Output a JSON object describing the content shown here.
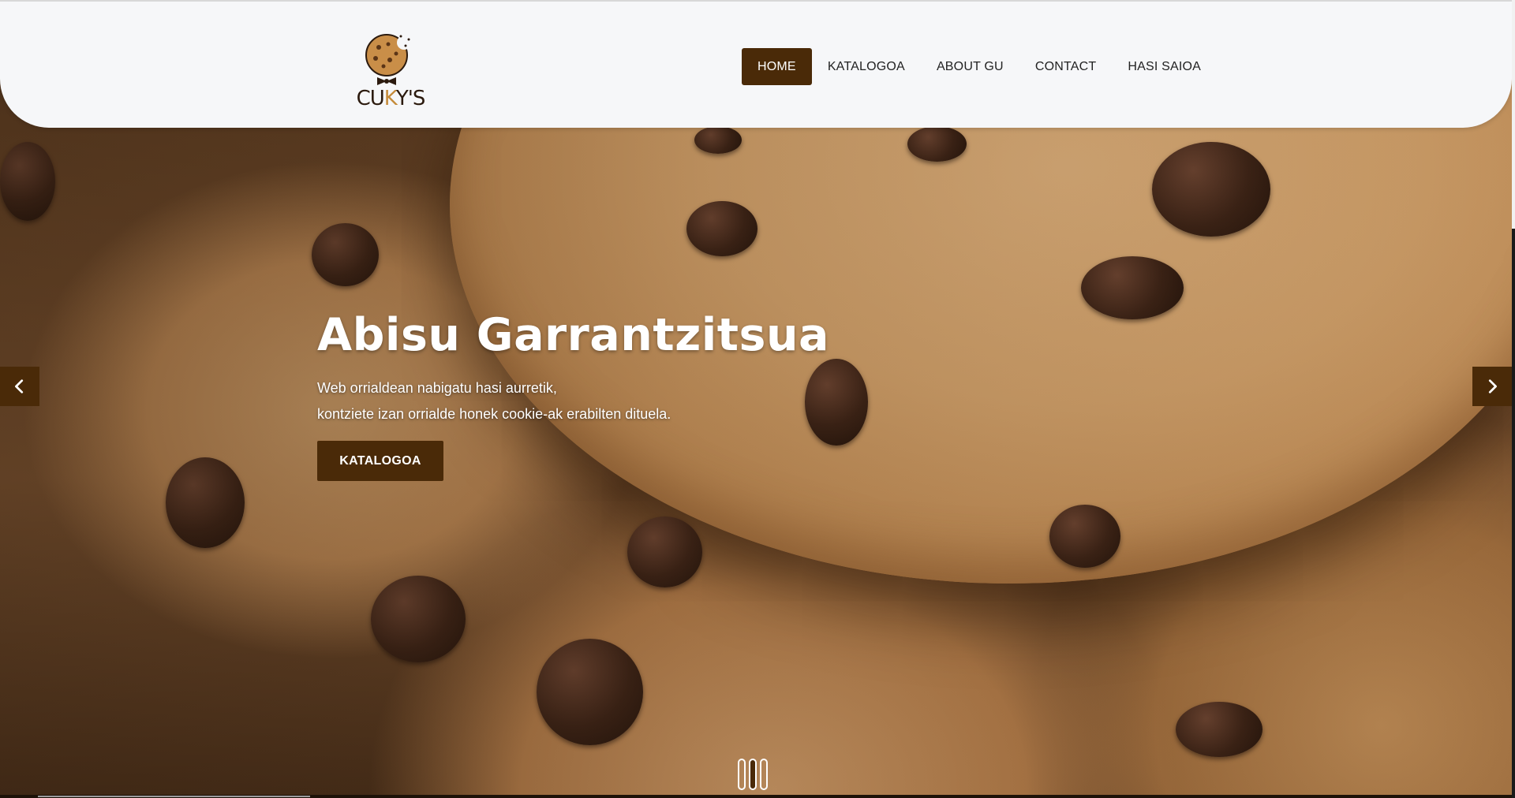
{
  "header": {
    "logo_text_left": "CU",
    "logo_text_k": "K",
    "logo_text_right": "Y'S",
    "nav": [
      {
        "label": "HOME",
        "active": true
      },
      {
        "label": "KATALOGOA",
        "active": false
      },
      {
        "label": "ABOUT GU",
        "active": false
      },
      {
        "label": "CONTACT",
        "active": false
      },
      {
        "label": "HASI SAIOA",
        "active": false
      }
    ]
  },
  "hero": {
    "title": "Abisu Garrantzitsua",
    "line1": "Web orrialdean nabigatu hasi aurretik,",
    "line2": "kontziete izan orrialde honek cookie-ak erabilten dituela.",
    "cta_label": "KATALOGOA"
  },
  "carousel": {
    "prev_icon": "chevron-left-icon",
    "next_icon": "chevron-right-icon",
    "slide_count": 3,
    "active_slide": 1
  },
  "colors": {
    "brand": "#4a2a08",
    "header_bg": "#f6f7f9",
    "logo_accent": "#c58b3a"
  }
}
